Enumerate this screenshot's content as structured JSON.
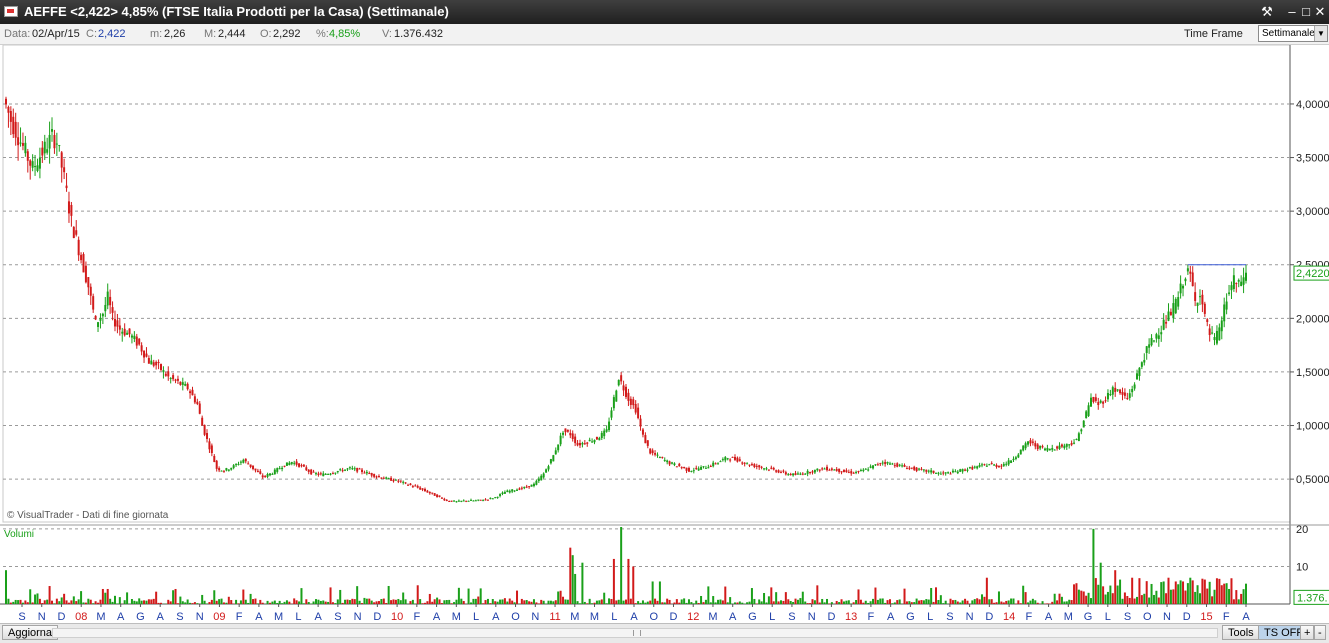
{
  "window": {
    "title": "AEFFE <2,422> 4,85%  (FTSE Italia Prodotti per la Casa)  (Settimanale)"
  },
  "infobar": {
    "data_label": "Data:",
    "data_value": "02/Apr/15",
    "close_label": "C:",
    "close_value": "2,422",
    "min_label": "m:",
    "min_value": "2,26",
    "max_label": "M:",
    "max_value": "2,444",
    "open_label": "O:",
    "open_value": "2,292",
    "pct_label": "%:",
    "pct_value": "4,85%",
    "vol_label": "V:",
    "vol_value": "1.376.432",
    "timeframe_label": "Time Frame",
    "timeframe_value": "Settimanale"
  },
  "bottombar": {
    "aggiorna": "Aggiorna",
    "tools": "Tools",
    "ts_off": "TS OFF",
    "plus": "+",
    "minus": "-"
  },
  "chart_data": {
    "type": "candlestick",
    "price_axis": {
      "ticks": [
        "4,0000",
        "3,5000",
        "3,0000",
        "2,5000",
        "2,0000",
        "1,5000",
        "1,0000",
        "0,5000"
      ],
      "ylim": [
        0.1,
        4.55
      ]
    },
    "current_price_label": "2,4220",
    "resistance_level": 2.5,
    "watermark": "© VisualTrader - Dati di fine giornata",
    "volume_panel": {
      "label": "Volumi",
      "ticks": [
        "20",
        "10"
      ],
      "current_label": "1.376.",
      "ylim": [
        0,
        20.5
      ]
    },
    "x_axis": {
      "labels": [
        {
          "t": "S",
          "c": "#1e3ea8"
        },
        {
          "t": "N",
          "c": "#1e3ea8"
        },
        {
          "t": "D",
          "c": "#1e3ea8"
        },
        {
          "t": "08",
          "c": "#d21a1a"
        },
        {
          "t": "M",
          "c": "#1e3ea8"
        },
        {
          "t": "A",
          "c": "#1e3ea8"
        },
        {
          "t": "G",
          "c": "#1e3ea8"
        },
        {
          "t": "A",
          "c": "#1e3ea8"
        },
        {
          "t": "S",
          "c": "#1e3ea8"
        },
        {
          "t": "N",
          "c": "#1e3ea8"
        },
        {
          "t": "09",
          "c": "#d21a1a"
        },
        {
          "t": "F",
          "c": "#1e3ea8"
        },
        {
          "t": "A",
          "c": "#1e3ea8"
        },
        {
          "t": "M",
          "c": "#1e3ea8"
        },
        {
          "t": "L",
          "c": "#1e3ea8"
        },
        {
          "t": "A",
          "c": "#1e3ea8"
        },
        {
          "t": "S",
          "c": "#1e3ea8"
        },
        {
          "t": "N",
          "c": "#1e3ea8"
        },
        {
          "t": "D",
          "c": "#1e3ea8"
        },
        {
          "t": "10",
          "c": "#d21a1a"
        },
        {
          "t": "F",
          "c": "#1e3ea8"
        },
        {
          "t": "A",
          "c": "#1e3ea8"
        },
        {
          "t": "M",
          "c": "#1e3ea8"
        },
        {
          "t": "L",
          "c": "#1e3ea8"
        },
        {
          "t": "A",
          "c": "#1e3ea8"
        },
        {
          "t": "O",
          "c": "#1e3ea8"
        },
        {
          "t": "N",
          "c": "#1e3ea8"
        },
        {
          "t": "11",
          "c": "#d21a1a"
        },
        {
          "t": "M",
          "c": "#1e3ea8"
        },
        {
          "t": "M",
          "c": "#1e3ea8"
        },
        {
          "t": "L",
          "c": "#1e3ea8"
        },
        {
          "t": "A",
          "c": "#1e3ea8"
        },
        {
          "t": "O",
          "c": "#1e3ea8"
        },
        {
          "t": "D",
          "c": "#1e3ea8"
        },
        {
          "t": "12",
          "c": "#d21a1a"
        },
        {
          "t": "M",
          "c": "#1e3ea8"
        },
        {
          "t": "A",
          "c": "#1e3ea8"
        },
        {
          "t": "G",
          "c": "#1e3ea8"
        },
        {
          "t": "L",
          "c": "#1e3ea8"
        },
        {
          "t": "S",
          "c": "#1e3ea8"
        },
        {
          "t": "N",
          "c": "#1e3ea8"
        },
        {
          "t": "D",
          "c": "#1e3ea8"
        },
        {
          "t": "13",
          "c": "#d21a1a"
        },
        {
          "t": "F",
          "c": "#1e3ea8"
        },
        {
          "t": "A",
          "c": "#1e3ea8"
        },
        {
          "t": "G",
          "c": "#1e3ea8"
        },
        {
          "t": "L",
          "c": "#1e3ea8"
        },
        {
          "t": "S",
          "c": "#1e3ea8"
        },
        {
          "t": "N",
          "c": "#1e3ea8"
        },
        {
          "t": "D",
          "c": "#1e3ea8"
        },
        {
          "t": "14",
          "c": "#d21a1a"
        },
        {
          "t": "F",
          "c": "#1e3ea8"
        },
        {
          "t": "A",
          "c": "#1e3ea8"
        },
        {
          "t": "M",
          "c": "#1e3ea8"
        },
        {
          "t": "G",
          "c": "#1e3ea8"
        },
        {
          "t": "L",
          "c": "#1e3ea8"
        },
        {
          "t": "S",
          "c": "#1e3ea8"
        },
        {
          "t": "O",
          "c": "#1e3ea8"
        },
        {
          "t": "N",
          "c": "#1e3ea8"
        },
        {
          "t": "D",
          "c": "#1e3ea8"
        },
        {
          "t": "15",
          "c": "#d21a1a"
        },
        {
          "t": "F",
          "c": "#1e3ea8"
        },
        {
          "t": "A",
          "c": "#1e3ea8"
        }
      ]
    },
    "price_path": [
      [
        0,
        4.05
      ],
      [
        3,
        3.85
      ],
      [
        8,
        3.6
      ],
      [
        12,
        3.4
      ],
      [
        16,
        3.55
      ],
      [
        20,
        3.7
      ],
      [
        22,
        3.65
      ],
      [
        25,
        3.3
      ],
      [
        28,
        2.9
      ],
      [
        31,
        2.65
      ],
      [
        35,
        2.3
      ],
      [
        38,
        1.95
      ],
      [
        41,
        2.05
      ],
      [
        43,
        2.2
      ],
      [
        45,
        2.0
      ],
      [
        48,
        1.9
      ],
      [
        52,
        1.85
      ],
      [
        56,
        1.75
      ],
      [
        60,
        1.6
      ],
      [
        64,
        1.55
      ],
      [
        68,
        1.45
      ],
      [
        72,
        1.4
      ],
      [
        76,
        1.35
      ],
      [
        80,
        1.2
      ],
      [
        82,
        1.0
      ],
      [
        85,
        0.8
      ],
      [
        88,
        0.6
      ],
      [
        91,
        0.58
      ],
      [
        95,
        0.62
      ],
      [
        99,
        0.68
      ],
      [
        103,
        0.6
      ],
      [
        107,
        0.52
      ],
      [
        111,
        0.56
      ],
      [
        115,
        0.62
      ],
      [
        119,
        0.66
      ],
      [
        123,
        0.62
      ],
      [
        127,
        0.56
      ],
      [
        131,
        0.54
      ],
      [
        135,
        0.56
      ],
      [
        139,
        0.58
      ],
      [
        143,
        0.6
      ],
      [
        147,
        0.58
      ],
      [
        151,
        0.55
      ],
      [
        155,
        0.52
      ],
      [
        159,
        0.5
      ],
      [
        163,
        0.48
      ],
      [
        167,
        0.45
      ],
      [
        171,
        0.42
      ],
      [
        175,
        0.38
      ],
      [
        179,
        0.34
      ],
      [
        183,
        0.3
      ],
      [
        187,
        0.29
      ],
      [
        191,
        0.3
      ],
      [
        195,
        0.3
      ],
      [
        199,
        0.31
      ],
      [
        203,
        0.33
      ],
      [
        207,
        0.38
      ],
      [
        211,
        0.4
      ],
      [
        215,
        0.42
      ],
      [
        219,
        0.45
      ],
      [
        223,
        0.55
      ],
      [
        227,
        0.72
      ],
      [
        231,
        0.95
      ],
      [
        234,
        0.92
      ],
      [
        237,
        0.82
      ],
      [
        241,
        0.85
      ],
      [
        245,
        0.88
      ],
      [
        249,
        0.95
      ],
      [
        252,
        1.25
      ],
      [
        254,
        1.45
      ],
      [
        256,
        1.35
      ],
      [
        258,
        1.25
      ],
      [
        261,
        1.15
      ],
      [
        264,
        0.9
      ],
      [
        267,
        0.75
      ],
      [
        271,
        0.7
      ],
      [
        275,
        0.65
      ],
      [
        279,
        0.62
      ],
      [
        283,
        0.58
      ],
      [
        287,
        0.6
      ],
      [
        291,
        0.62
      ],
      [
        295,
        0.66
      ],
      [
        299,
        0.7
      ],
      [
        303,
        0.68
      ],
      [
        307,
        0.64
      ],
      [
        311,
        0.62
      ],
      [
        315,
        0.6
      ],
      [
        319,
        0.58
      ],
      [
        323,
        0.55
      ],
      [
        327,
        0.54
      ],
      [
        331,
        0.56
      ],
      [
        335,
        0.58
      ],
      [
        339,
        0.6
      ],
      [
        343,
        0.59
      ],
      [
        347,
        0.57
      ],
      [
        351,
        0.56
      ],
      [
        355,
        0.58
      ],
      [
        359,
        0.62
      ],
      [
        363,
        0.66
      ],
      [
        367,
        0.64
      ],
      [
        371,
        0.62
      ],
      [
        375,
        0.6
      ],
      [
        379,
        0.58
      ],
      [
        383,
        0.57
      ],
      [
        387,
        0.55
      ],
      [
        391,
        0.56
      ],
      [
        395,
        0.58
      ],
      [
        399,
        0.6
      ],
      [
        403,
        0.62
      ],
      [
        407,
        0.64
      ],
      [
        411,
        0.62
      ],
      [
        415,
        0.66
      ],
      [
        419,
        0.74
      ],
      [
        423,
        0.85
      ],
      [
        427,
        0.8
      ],
      [
        431,
        0.78
      ],
      [
        435,
        0.8
      ],
      [
        439,
        0.82
      ],
      [
        443,
        0.86
      ],
      [
        446,
        1.05
      ],
      [
        449,
        1.25
      ],
      [
        452,
        1.2
      ],
      [
        455,
        1.25
      ],
      [
        458,
        1.35
      ],
      [
        461,
        1.3
      ],
      [
        464,
        1.25
      ],
      [
        467,
        1.4
      ],
      [
        470,
        1.6
      ],
      [
        473,
        1.75
      ],
      [
        476,
        1.85
      ],
      [
        479,
        1.95
      ],
      [
        482,
        2.05
      ],
      [
        485,
        2.2
      ],
      [
        488,
        2.42
      ],
      [
        490,
        2.4
      ],
      [
        492,
        2.15
      ],
      [
        494,
        2.25
      ],
      [
        496,
        2.0
      ],
      [
        498,
        1.85
      ],
      [
        500,
        1.8
      ],
      [
        502,
        1.88
      ],
      [
        504,
        2.1
      ],
      [
        506,
        2.25
      ],
      [
        508,
        2.35
      ],
      [
        510,
        2.3
      ],
      [
        512,
        2.4
      ]
    ],
    "volume_spikes": [
      [
        0,
        9
      ],
      [
        40,
        4
      ],
      [
        41,
        3
      ],
      [
        42,
        4
      ],
      [
        233,
        15
      ],
      [
        234,
        13
      ],
      [
        235,
        8
      ],
      [
        238,
        11
      ],
      [
        251,
        12
      ],
      [
        254,
        20.5
      ],
      [
        257,
        12
      ],
      [
        259,
        10
      ],
      [
        267,
        6
      ],
      [
        270,
        6
      ],
      [
        405,
        7
      ],
      [
        449,
        20
      ],
      [
        452,
        11
      ],
      [
        458,
        9
      ],
      [
        465,
        7
      ],
      [
        478,
        6
      ],
      [
        480,
        7
      ],
      [
        483,
        6
      ],
      [
        486,
        6
      ],
      [
        489,
        7
      ],
      [
        492,
        5
      ],
      [
        502,
        5
      ],
      [
        505,
        4
      ]
    ],
    "colors": {
      "up": "#1aa01a",
      "down": "#d21a1a",
      "grid": "#9a9a9a",
      "resistance": "#3b5bd6"
    }
  }
}
